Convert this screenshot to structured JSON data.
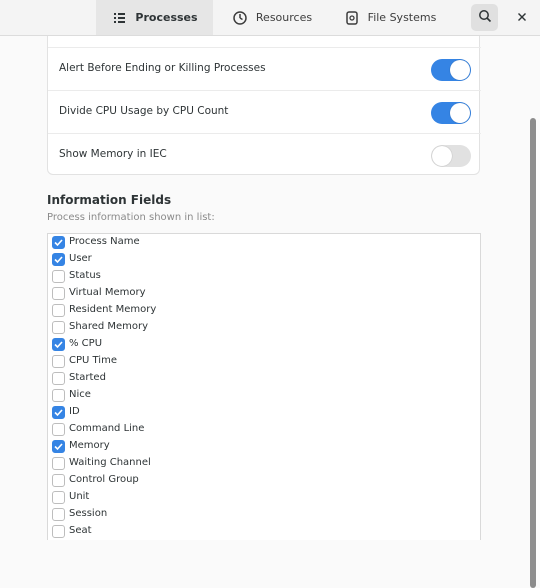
{
  "tabs": {
    "processes": "Processes",
    "resources": "Resources",
    "file_systems": "File Systems"
  },
  "switches": [
    {
      "label": "Alert Before Ending or Killing Processes",
      "on": true
    },
    {
      "label": "Divide CPU Usage by CPU Count",
      "on": true
    },
    {
      "label": "Show Memory in IEC",
      "on": false
    }
  ],
  "information_fields": {
    "title": "Information Fields",
    "subtitle": "Process information shown in list:",
    "items": [
      {
        "label": "Process Name",
        "checked": true
      },
      {
        "label": "User",
        "checked": true
      },
      {
        "label": "Status",
        "checked": false
      },
      {
        "label": "Virtual Memory",
        "checked": false
      },
      {
        "label": "Resident Memory",
        "checked": false
      },
      {
        "label": "Shared Memory",
        "checked": false
      },
      {
        "label": "% CPU",
        "checked": true
      },
      {
        "label": "CPU Time",
        "checked": false
      },
      {
        "label": "Started",
        "checked": false
      },
      {
        "label": "Nice",
        "checked": false
      },
      {
        "label": "ID",
        "checked": true
      },
      {
        "label": "Command Line",
        "checked": false
      },
      {
        "label": "Memory",
        "checked": true
      },
      {
        "label": "Waiting Channel",
        "checked": false
      },
      {
        "label": "Control Group",
        "checked": false
      },
      {
        "label": "Unit",
        "checked": false
      },
      {
        "label": "Session",
        "checked": false
      },
      {
        "label": "Seat",
        "checked": false
      }
    ]
  },
  "colors": {
    "accent": "#3584e4"
  }
}
